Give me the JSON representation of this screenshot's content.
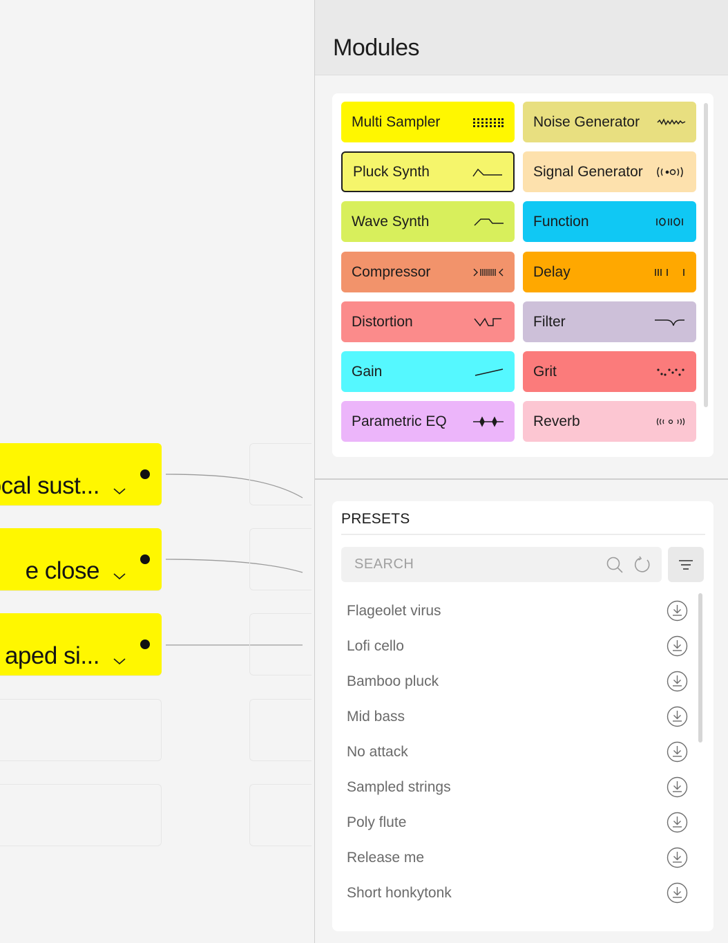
{
  "canvas": {
    "tracks": [
      {
        "name": "ocal sust...",
        "filled": true
      },
      {
        "name": "e close",
        "filled": true
      },
      {
        "name": "aped si...",
        "filled": true
      },
      {
        "name": "",
        "filled": false
      },
      {
        "name": "",
        "filled": false
      }
    ]
  },
  "modules": {
    "title": "Modules",
    "items": [
      {
        "label": "Multi Sampler",
        "icon": "multi-sampler-grid-icon",
        "color": "#fff700",
        "glyph": "⠿⠿⠿"
      },
      {
        "label": "Noise Generator",
        "icon": "noise-wave-icon",
        "color": "#e8df80",
        "glyph": "〰〰"
      },
      {
        "label": "Pluck Synth",
        "icon": "pluck-envelope-icon",
        "color": "#f5f56b",
        "glyph": "",
        "selected": true
      },
      {
        "label": "Signal Generator",
        "icon": "signal-broadcast-icon",
        "color": "#fde1ad",
        "glyph": "((•o))"
      },
      {
        "label": "Wave Synth",
        "icon": "wave-envelope-icon",
        "color": "#d8ef5c",
        "glyph": ""
      },
      {
        "label": "Function",
        "icon": "function-binary-icon",
        "color": "#10c8f4",
        "glyph": "IOIIO"
      },
      {
        "label": "Compressor",
        "icon": "compressor-icon",
        "color": "#f2936b",
        "glyph": ">IIIIII<"
      },
      {
        "label": "Delay",
        "icon": "delay-ticks-icon",
        "color": "#ffa800",
        "glyph": "III I   I"
      },
      {
        "label": "Distortion",
        "icon": "distortion-wave-icon",
        "color": "#fb8b8b",
        "glyph": ""
      },
      {
        "label": "Filter",
        "icon": "filter-curve-icon",
        "color": "#cdc0d9",
        "glyph": ""
      },
      {
        "label": "Gain",
        "icon": "gain-slope-icon",
        "color": "#55f8ff",
        "glyph": ""
      },
      {
        "label": "Grit",
        "icon": "grit-dots-icon",
        "color": "#fb7b7b",
        "glyph": "⠐⠂⠐⠂"
      },
      {
        "label": "Parametric EQ",
        "icon": "parametric-eq-icon",
        "color": "#ecb5fa",
        "glyph": "⟡"
      },
      {
        "label": "Reverb",
        "icon": "reverb-waves-icon",
        "color": "#fcc6d2",
        "glyph": "((•))"
      }
    ]
  },
  "presets": {
    "title": "PRESETS",
    "search_placeholder": "SEARCH",
    "items": [
      "Flageolet virus",
      "Lofi cello",
      "Bamboo pluck",
      "Mid bass",
      "No attack",
      "Sampled strings",
      "Poly flute",
      "Release me",
      "Short honkytonk"
    ]
  }
}
